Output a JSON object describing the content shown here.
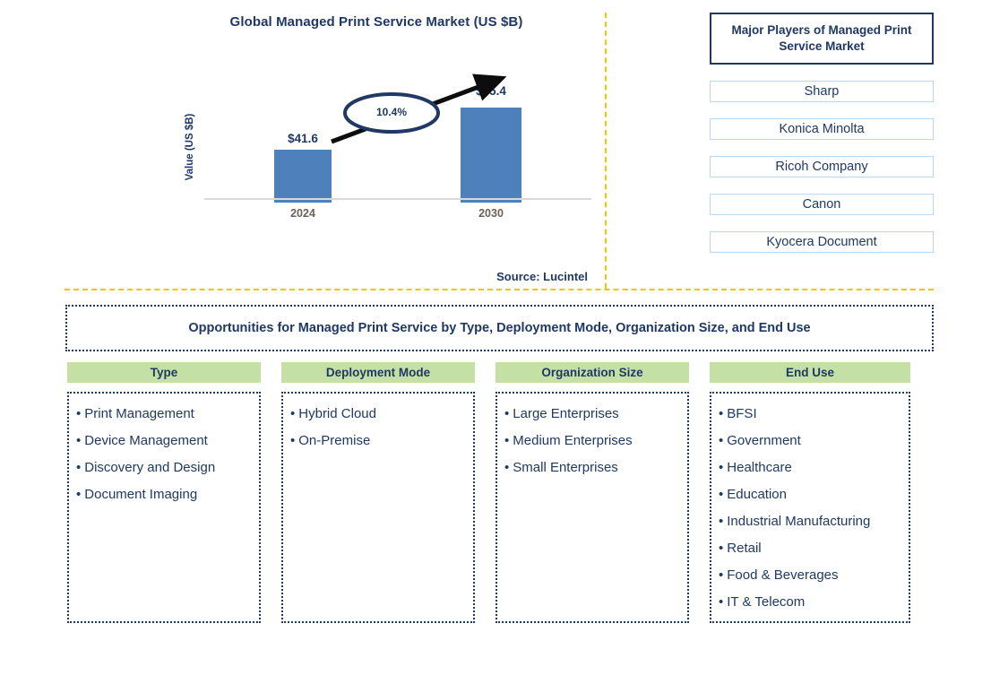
{
  "chart_panel": {
    "title": "Global Managed Print Service Market (US $B)",
    "source": "Source: Lucintel"
  },
  "chart_data": {
    "type": "bar",
    "title": "Global Managed Print Service Market (US $B)",
    "xlabel": "",
    "ylabel": "Value (US $B)",
    "categories": [
      "2024",
      "2030"
    ],
    "values": [
      41.6,
      75.4
    ],
    "value_labels": [
      "$41.6",
      "$75.4"
    ],
    "ylim": [
      0,
      80
    ],
    "grid": false,
    "legend": "none",
    "bar_color": "#4E81BC",
    "annotations": [
      {
        "name": "cagr",
        "text": "10.4%",
        "shape": "ellipse-with-arrow",
        "from": "2024",
        "to": "2030"
      }
    ],
    "source": "Source: Lucintel"
  },
  "players": {
    "title": "Major Players of Managed Print Service Market",
    "items": [
      "Sharp",
      "Konica Minolta",
      "Ricoh Company",
      "Canon",
      "Kyocera Document"
    ]
  },
  "opportunities": {
    "banner": "Opportunities for Managed Print Service by Type, Deployment Mode, Organization Size, and End Use",
    "columns": [
      {
        "header": "Type",
        "items": [
          "Print Management",
          "Device Management",
          "Discovery and Design",
          "Document Imaging"
        ]
      },
      {
        "header": "Deployment Mode",
        "items": [
          "Hybrid Cloud",
          "On-Premise"
        ]
      },
      {
        "header": "Organization Size",
        "items": [
          "Large Enterprises",
          "Medium Enterprises",
          "Small Enterprises"
        ]
      },
      {
        "header": "End Use",
        "items": [
          "BFSI",
          "Government",
          "Healthcare",
          "Education",
          "Industrial Manufacturing",
          "Retail",
          "Food & Beverages",
          "IT & Telecom"
        ]
      }
    ]
  },
  "colors": {
    "navy": "#1F3864",
    "bar_blue": "#4E81BC",
    "header_green": "#C5E0A5",
    "divider_orange": "#FFC000",
    "player_border": "#BDD7EE",
    "tick_gray": "#6B6155"
  },
  "bullet_glyph": "•"
}
